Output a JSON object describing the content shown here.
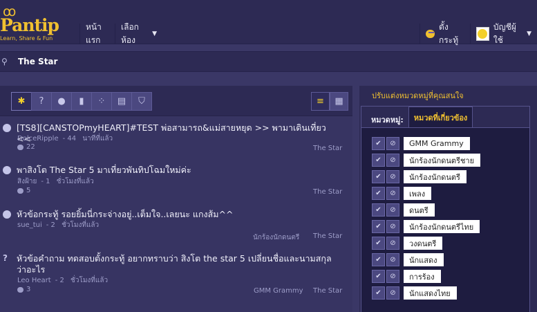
{
  "brand": {
    "rings": "ꝏ",
    "name": "Pantip",
    "tagline": "Learn, Share & Fun"
  },
  "nav": {
    "home": "หน้าแรก",
    "forums": "เลือกห้อง",
    "post": "ตั้งกระทู้",
    "account": "บัญชีผู้ใช้"
  },
  "breadcrumb": {
    "title": "The Star"
  },
  "toolbar": {
    "filters": [
      {
        "icon": "star-icon",
        "glyph": "✱"
      },
      {
        "icon": "question-icon",
        "glyph": "?"
      },
      {
        "icon": "chat-icon",
        "glyph": "●"
      },
      {
        "icon": "poll-icon",
        "glyph": "▮"
      },
      {
        "icon": "review-icon",
        "glyph": "⁘"
      },
      {
        "icon": "news-icon",
        "glyph": "▤"
      },
      {
        "icon": "shop-icon",
        "glyph": "⛉"
      }
    ],
    "views": [
      {
        "icon": "list-view-icon",
        "glyph": "≡"
      },
      {
        "icon": "grid-view-icon",
        "glyph": "▦"
      }
    ]
  },
  "topics": [
    {
      "type": "chat",
      "title": "[TS8][CANSTOPmyHEART]#TEST พ่อสามารถ&แม่สายหยุด >> พามาเดินเที่ยว <<",
      "author": "DolceRipple",
      "count": "44",
      "time": "นาทีที่แล้ว",
      "comments": "22",
      "tags": [
        "The Star"
      ]
    },
    {
      "type": "chat",
      "title": "พาสิงโต The Star 5 มาเที่ยวพันทิปโฉมใหม่ค่ะ",
      "author": "สิงฝ้าย",
      "count": "1",
      "time": "ชั่วโมงที่แล้ว",
      "comments": "5",
      "tags": [
        "The Star"
      ]
    },
    {
      "type": "chat",
      "title": "หัวข้อกระทู้ รอยยิ้มนี่กระจ่างอยู่..เต็มใจ..เลยนะ แกงส้ม^^",
      "author": "sue_tui",
      "count": "2",
      "time": "ชั่วโมงที่แล้ว",
      "comments": "",
      "tags": [
        "นักร้องนักดนตรี",
        "The Star"
      ]
    },
    {
      "type": "question",
      "title": "หัวข้อคำถาม ทดสอบตั้งกระทู้ อยากทราบว่า สิงโต the star 5 เปลี่ยนชื่อและนามสกุล ว่าอะไร",
      "author": "Leo  Heart",
      "count": "2",
      "time": "ชั่วโมงที่แล้ว",
      "comments": "3",
      "tags": [
        "GMM Grammy",
        "The Star"
      ]
    }
  ],
  "sidebar": {
    "heading": "ปรับแต่งหมวดหมู่ที่คุณสนใจ",
    "tab_label": "หมวดหมู่:",
    "tab_active": "หมวดที่เกี่ยวข้อง",
    "categories": [
      "GMM Grammy",
      "นักร้องนักดนตรีชาย",
      "นักร้องนักดนตรี",
      "เพลง",
      "ดนตรี",
      "นักร้องนักดนตรีไทย",
      "วงดนตรี",
      "นักแสดง",
      "การร้อง",
      "นักแสดงไทย"
    ]
  },
  "colors": {
    "accent": "#f0c030",
    "background": "#3a3766",
    "panel": "#1e1c40"
  }
}
